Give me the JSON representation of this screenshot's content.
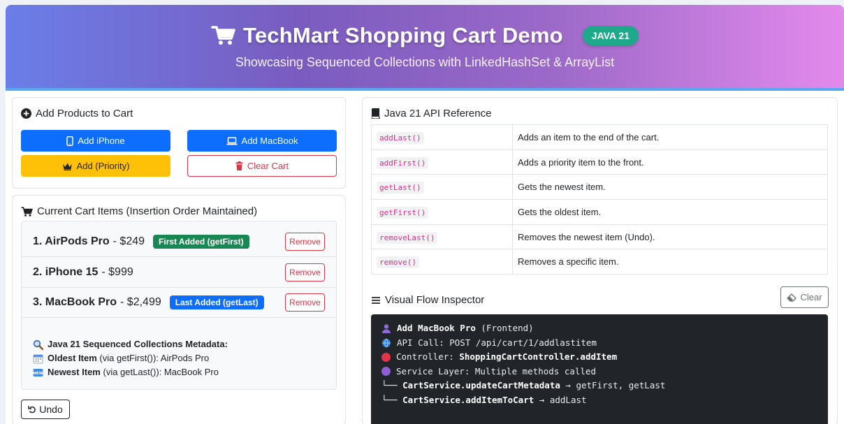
{
  "header": {
    "title": "TechMart Shopping Cart Demo",
    "badge": "JAVA 21",
    "subtitle": "Showcasing Sequenced Collections with LinkedHashSet & ArrayList",
    "cart_icon": "cart-icon"
  },
  "add_products": {
    "title": "Add Products to Cart",
    "add_iphone": "Add iPhone",
    "add_macbook": "Add MacBook",
    "add_priority": "Add (Priority)",
    "clear_cart": "Clear Cart"
  },
  "cart": {
    "title": "Current Cart Items (Insertion Order Maintained)",
    "items": [
      {
        "name": "1. AirPods Pro",
        "price": "- $249",
        "badge": "First Added (getFirst)",
        "remove": "Remove"
      },
      {
        "name": "2. iPhone 15",
        "price": "- $999",
        "badge": "",
        "remove": "Remove"
      },
      {
        "name": "3. MacBook Pro",
        "price": "- $2,499",
        "badge": "Last Added (getLast)",
        "remove": "Remove"
      }
    ],
    "metadata_title": "Java 21 Sequenced Collections Metadata:",
    "oldest_label": "Oldest Item",
    "oldest_value": "(via getFirst()): AirPods Pro",
    "newest_label": "Newest Item",
    "newest_value": "(via getLast()): MacBook Pro",
    "undo": "Undo"
  },
  "api_reference": {
    "title": "Java 21 API Reference",
    "rows": [
      {
        "method": "addLast()",
        "desc": "Adds an item to the end of the cart."
      },
      {
        "method": "addFirst()",
        "desc": "Adds a priority item to the front."
      },
      {
        "method": "getLast()",
        "desc": "Gets the newest item."
      },
      {
        "method": "getFirst()",
        "desc": "Gets the oldest item."
      },
      {
        "method": "removeLast()",
        "desc": "Removes the newest item (Undo)."
      },
      {
        "method": "remove()",
        "desc": "Removes a specific item."
      }
    ]
  },
  "flow": {
    "title": "Visual Flow Inspector",
    "clear": "Clear",
    "lines": {
      "l1_bold": "Add MacBook Pro",
      "l1_rest": "(Frontend)",
      "l2": "API Call: POST /api/cart/1/addlastitem",
      "l3_pre": "Controller:",
      "l3_bold": "ShoppingCartController.addItem",
      "l4": "Service Layer: Multiple methods called",
      "l5_pre": "└──",
      "l5_bold": "CartService.updateCartMetadata",
      "l5_rest": "→ getFirst, getLast",
      "l6_pre": "└──",
      "l6_bold": "CartService.addItemToCart",
      "l6_rest": "→ addLast"
    }
  },
  "colors": {
    "primary": "#0d6efd",
    "warning": "#ffc107",
    "danger": "#dc3545",
    "success": "#198754",
    "terminal_bg": "#212529"
  }
}
